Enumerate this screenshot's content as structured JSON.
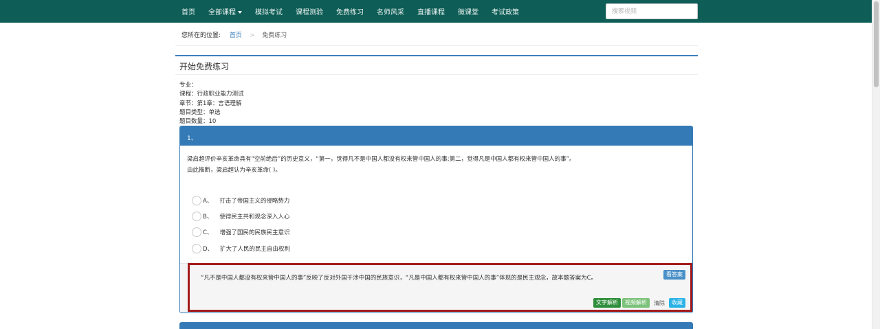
{
  "nav": {
    "items": [
      "首页",
      "全部课程",
      "模拟考试",
      "课程测验",
      "免费练习",
      "名师风采",
      "直播课程",
      "微课堂",
      "考试政策"
    ],
    "dropdown_index": 1,
    "search_placeholder": "搜索视频"
  },
  "breadcrumb": {
    "label": "您所在的位置:",
    "home": "首页",
    "separator": ">",
    "current": "免费练习"
  },
  "panel": {
    "title": "开始免费练习"
  },
  "meta": {
    "major": "专业：",
    "course": "课程：行政职业能力测试",
    "chapter": "章节：第1章：言语理解",
    "type": "题目类型：单选",
    "count": "题目数量：10"
  },
  "question": {
    "number": "1、",
    "text_line1": "梁启超评价辛亥革命具有“空前绝后”的历史意义，“第一，觉得凡不是中国人都没有权来管中国人的事;第二，觉得凡是中国人都有权来管中国人的事”。",
    "text_line2": "由此推断，梁启超认为辛亥革命( )。",
    "options": [
      {
        "letter": "A、",
        "text": "打击了帝国主义的侵略势力"
      },
      {
        "letter": "B、",
        "text": "使得民主共和观念深入人心"
      },
      {
        "letter": "C、",
        "text": "增强了国民的民族民主意识"
      },
      {
        "letter": "D、",
        "text": "扩大了人民的民主自由权利"
      }
    ],
    "answer": "“凡不是中国人都没有权来管中国人的事”反映了反对外国干涉中国的民族意识，“凡是中国人都有权来管中国人的事”体现的是民主观念，故本题答案为C。"
  },
  "buttons": {
    "see_answer": "看答案",
    "text_analysis": "文字解析",
    "video_analysis": "视频解析",
    "clear": "清除",
    "favorite": "收藏"
  },
  "colors": {
    "nav_bg": "#0e5d56",
    "primary": "#337ab7",
    "highlight_border": "#a31b1b"
  }
}
